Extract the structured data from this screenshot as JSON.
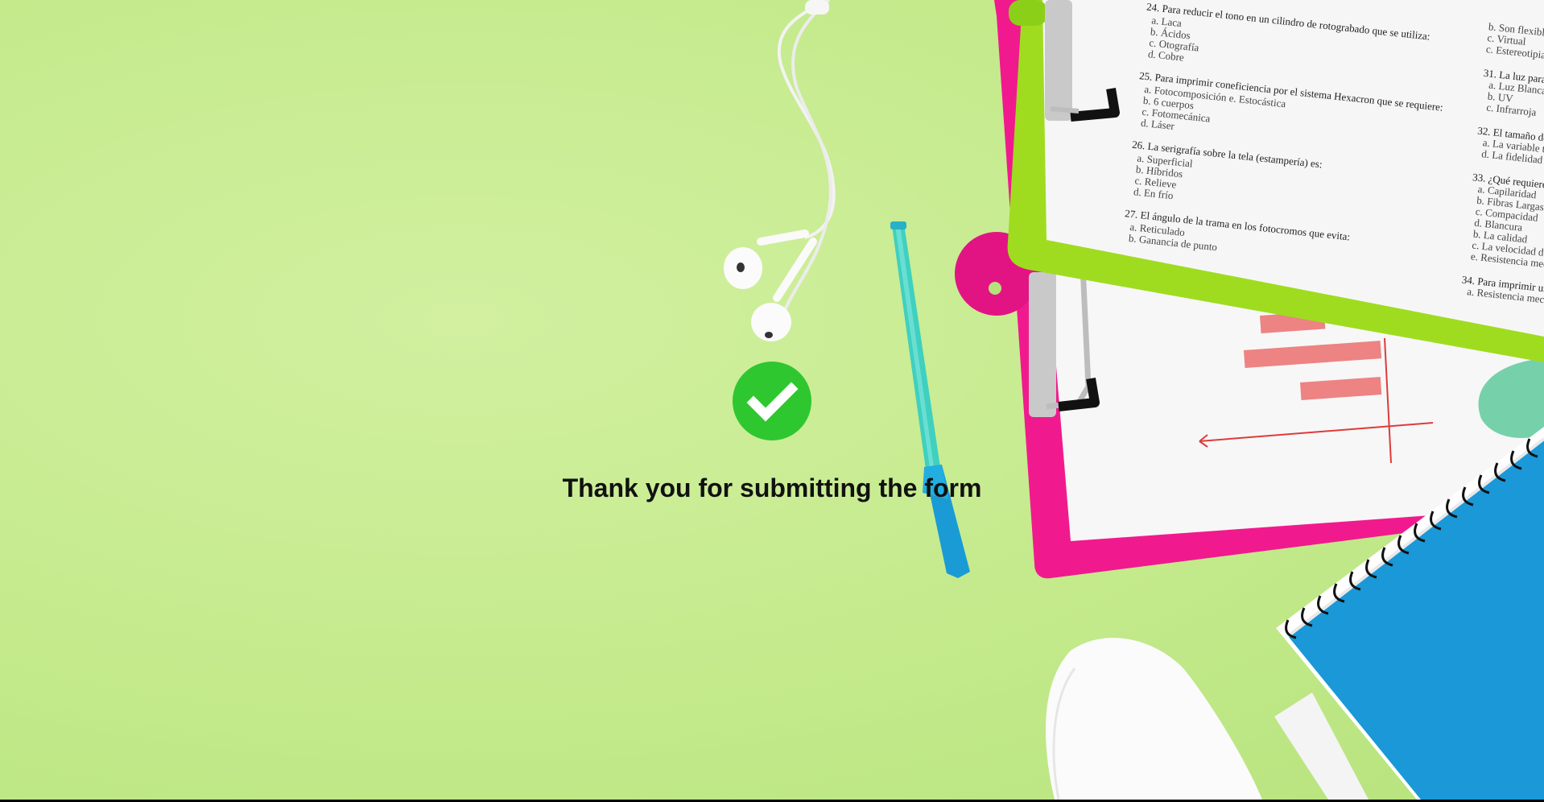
{
  "confirmation": {
    "message": "Thank you for submitting the form"
  },
  "icons": {
    "status": "check-circle-icon"
  },
  "colors": {
    "background": "#c6eb8f",
    "success_green": "#2fc72f",
    "message_text": "#111111"
  }
}
